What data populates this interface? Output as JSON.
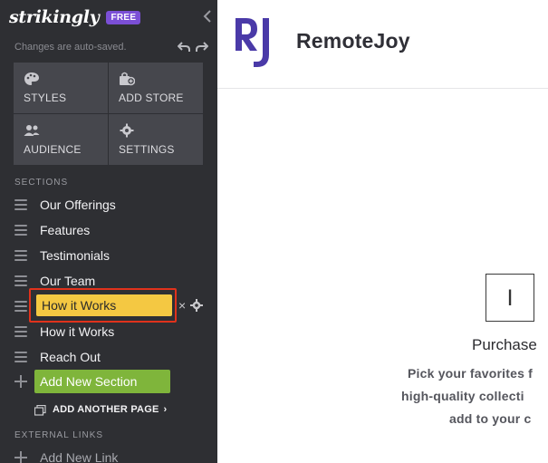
{
  "sidebar": {
    "brand": "strikingly",
    "badge": "FREE",
    "autosave_text": "Changes are auto-saved.",
    "tiles": [
      {
        "label": "STYLES",
        "icon": "palette-icon"
      },
      {
        "label": "ADD STORE",
        "icon": "store-bag-icon"
      },
      {
        "label": "AUDIENCE",
        "icon": "people-icon"
      },
      {
        "label": "SETTINGS",
        "icon": "gear-icon"
      }
    ],
    "sections_heading": "SECTIONS",
    "sections": [
      {
        "label": "Our Offerings"
      },
      {
        "label": "Features"
      },
      {
        "label": "Testimonials"
      },
      {
        "label": "Our Team"
      },
      {
        "label": "How it Works",
        "active": true
      },
      {
        "label": "How it Works"
      },
      {
        "label": "Reach Out"
      }
    ],
    "active_tools": {
      "close": "×",
      "icon": "gear-icon"
    },
    "add_section_label": "Add New Section",
    "add_page_label": "ADD ANOTHER PAGE",
    "add_page_chevron": "›",
    "external_heading": "EXTERNAL LINKS",
    "add_link_label": "Add New Link",
    "colors": {
      "sidebar_bg": "#2e2f33",
      "tile_bg": "#46474d",
      "active": "#f4c842",
      "add_btn": "#7fb53b",
      "highlight": "#e0321c",
      "badge": "#7b4fd6"
    }
  },
  "site": {
    "logo_text": "RJ",
    "title": "RemoteJoy",
    "icon_glyph": "I",
    "heading": "Purchase",
    "lines": [
      "Pick your favorites f",
      "high-quality collecti",
      "add to your c"
    ],
    "colors": {
      "logo": "#4a3aa8",
      "title": "#2f2f36"
    }
  }
}
